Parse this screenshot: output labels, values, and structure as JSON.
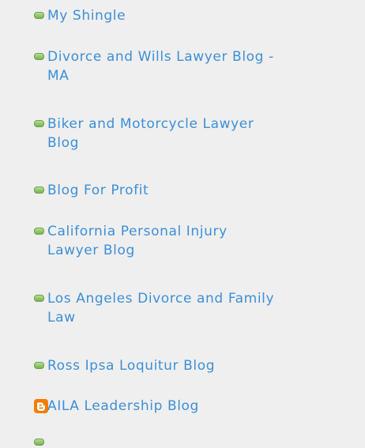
{
  "links": [
    {
      "label_line1": "My Shingle",
      "label_line2": ""
    },
    {
      "label_line1": "Divorce and Wills Lawyer Blog -",
      "label_line2": "MA"
    },
    {
      "label_line1": "Biker and Motorcycle Lawyer",
      "label_line2": "Blog"
    },
    {
      "label_line1": "Blog For Profit",
      "label_line2": ""
    },
    {
      "label_line1": "California Personal Injury",
      "label_line2": "Lawyer Blog"
    },
    {
      "label_line1": "Los Angeles Divorce and Family",
      "label_line2": "Law"
    },
    {
      "label_line1": "Ross Ipsa Loquitur Blog",
      "label_line2": ""
    },
    {
      "label_line1": "AILA Leadership Blog",
      "label_line2": ""
    },
    {
      "label_line1": "",
      "label_line2": ""
    }
  ],
  "icons": {
    "bullet": "green-bullet-icon",
    "blogger": "blogger-icon"
  },
  "colors": {
    "background": "#efefef",
    "link": "#3d8fd6",
    "bullet": "#8fc76c",
    "blogger": "#f57d00"
  }
}
